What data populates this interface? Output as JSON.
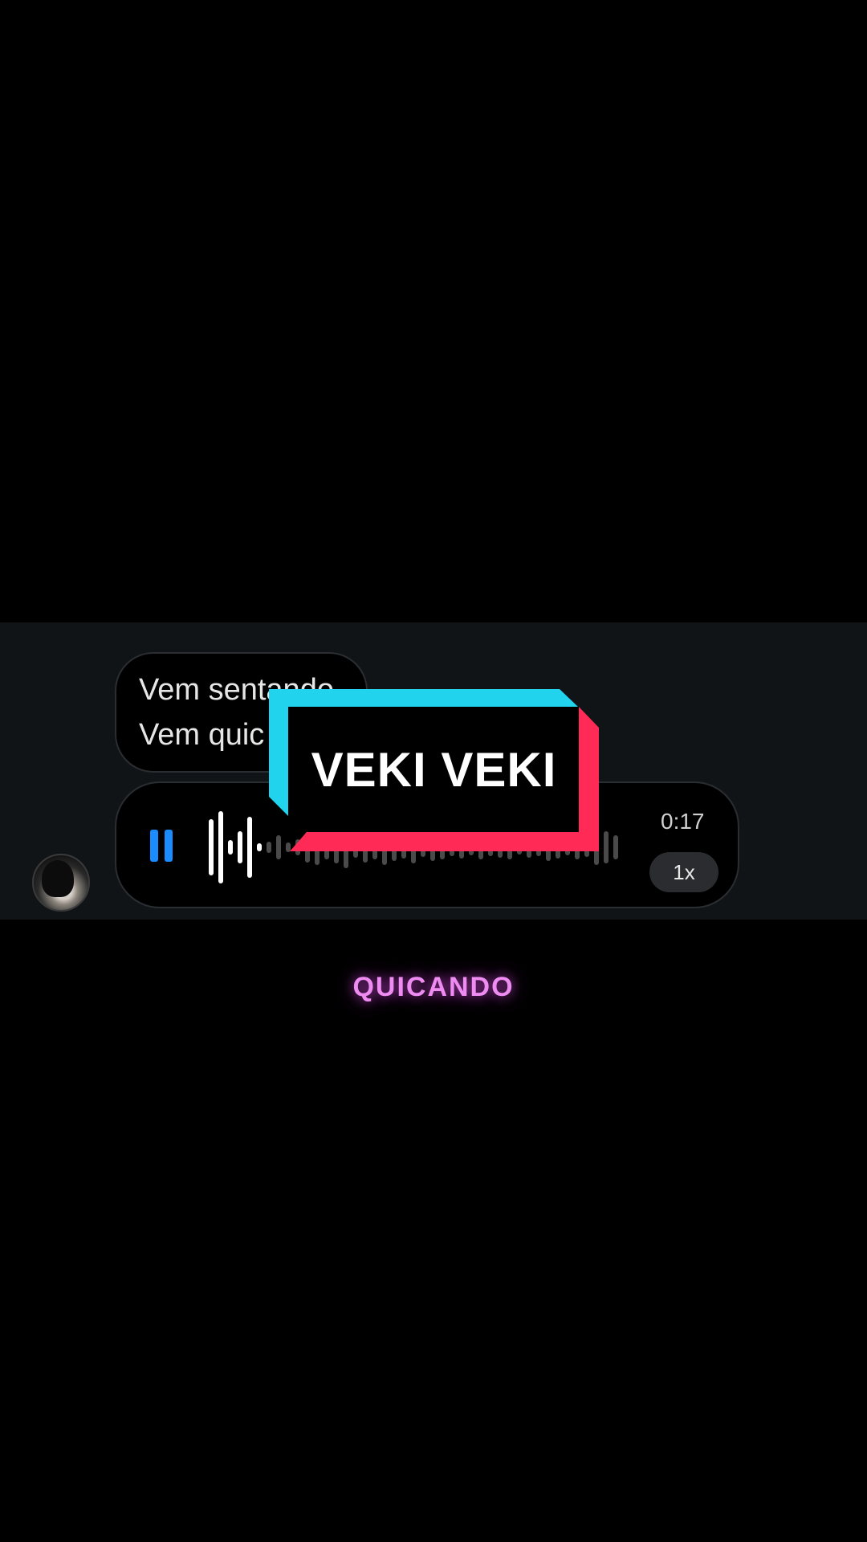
{
  "chat": {
    "message_lines": [
      "Vem sentando",
      "Vem quic"
    ],
    "voice_message": {
      "duration": "0:17",
      "playback_speed": "1x",
      "state": "playing",
      "progress": 0.14,
      "icon": "pause-icon",
      "accent_color": "#1a8cff"
    }
  },
  "overlay": {
    "title": "VEKI VEKI",
    "colors": {
      "cyan": "#22d3ee",
      "red": "#ff2a55"
    }
  },
  "caption": {
    "text": "QUICANDO",
    "color": "#ee8cf2"
  }
}
